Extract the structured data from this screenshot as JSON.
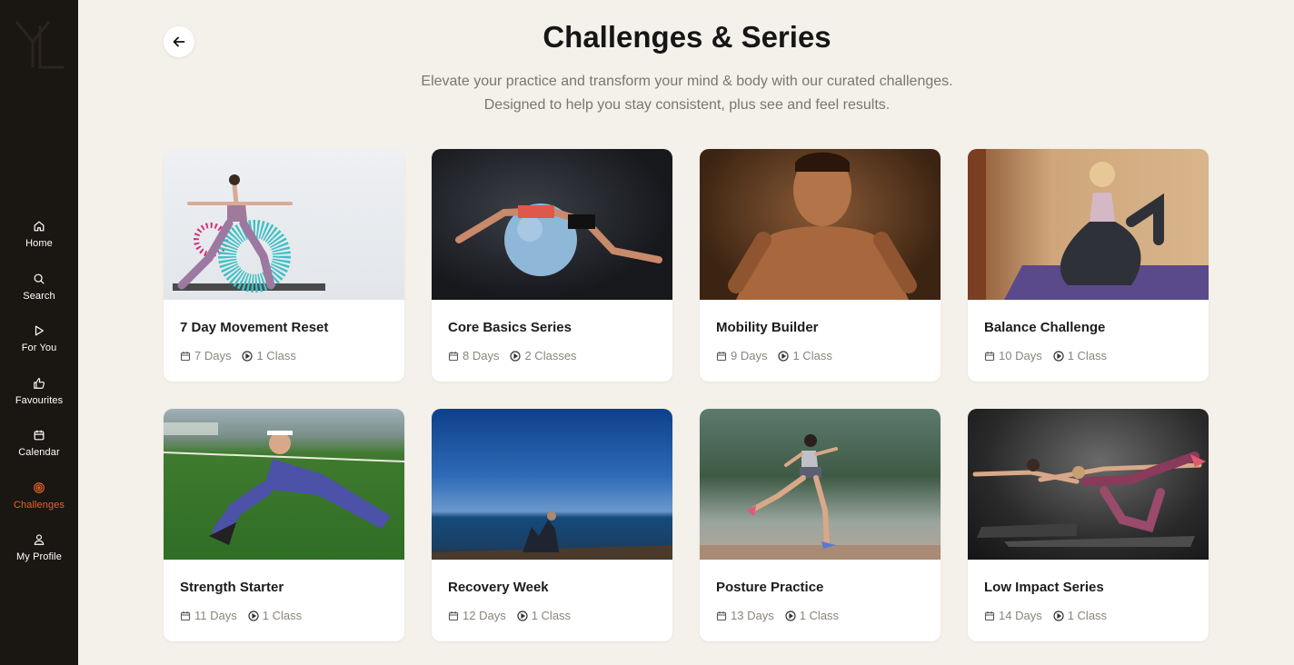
{
  "nav": {
    "items": [
      {
        "label": "Home",
        "icon": "home-icon"
      },
      {
        "label": "Search",
        "icon": "search-icon"
      },
      {
        "label": "For You",
        "icon": "play-icon"
      },
      {
        "label": "Favourites",
        "icon": "thumbs-up-icon"
      },
      {
        "label": "Calendar",
        "icon": "calendar-icon"
      },
      {
        "label": "Challenges",
        "icon": "target-icon",
        "active": true
      },
      {
        "label": "My Profile",
        "icon": "user-icon"
      }
    ]
  },
  "header": {
    "title": "Challenges & Series",
    "subtitle_line1": "Elevate your practice and transform your mind & body with our curated challenges.",
    "subtitle_line2": "Designed to help you stay consistent, plus see and feel results."
  },
  "cards": [
    {
      "title": "7 Day Movement Reset",
      "days": "7 Days",
      "classes": "1 Class"
    },
    {
      "title": "Core Basics Series",
      "days": "8 Days",
      "classes": "2 Classes"
    },
    {
      "title": "Mobility Builder",
      "days": "9 Days",
      "classes": "1 Class"
    },
    {
      "title": "Balance Challenge",
      "days": "10 Days",
      "classes": "1 Class"
    },
    {
      "title": "Strength Starter",
      "days": "11 Days",
      "classes": "1 Class"
    },
    {
      "title": "Recovery Week",
      "days": "12 Days",
      "classes": "1 Class"
    },
    {
      "title": "Posture Practice",
      "days": "13 Days",
      "classes": "1 Class"
    },
    {
      "title": "Low Impact Series",
      "days": "14 Days",
      "classes": "1 Class"
    }
  ],
  "colors": {
    "accent": "#e8622c",
    "sidebar_bg": "#1a1612",
    "page_bg": "#f4f1ea"
  }
}
